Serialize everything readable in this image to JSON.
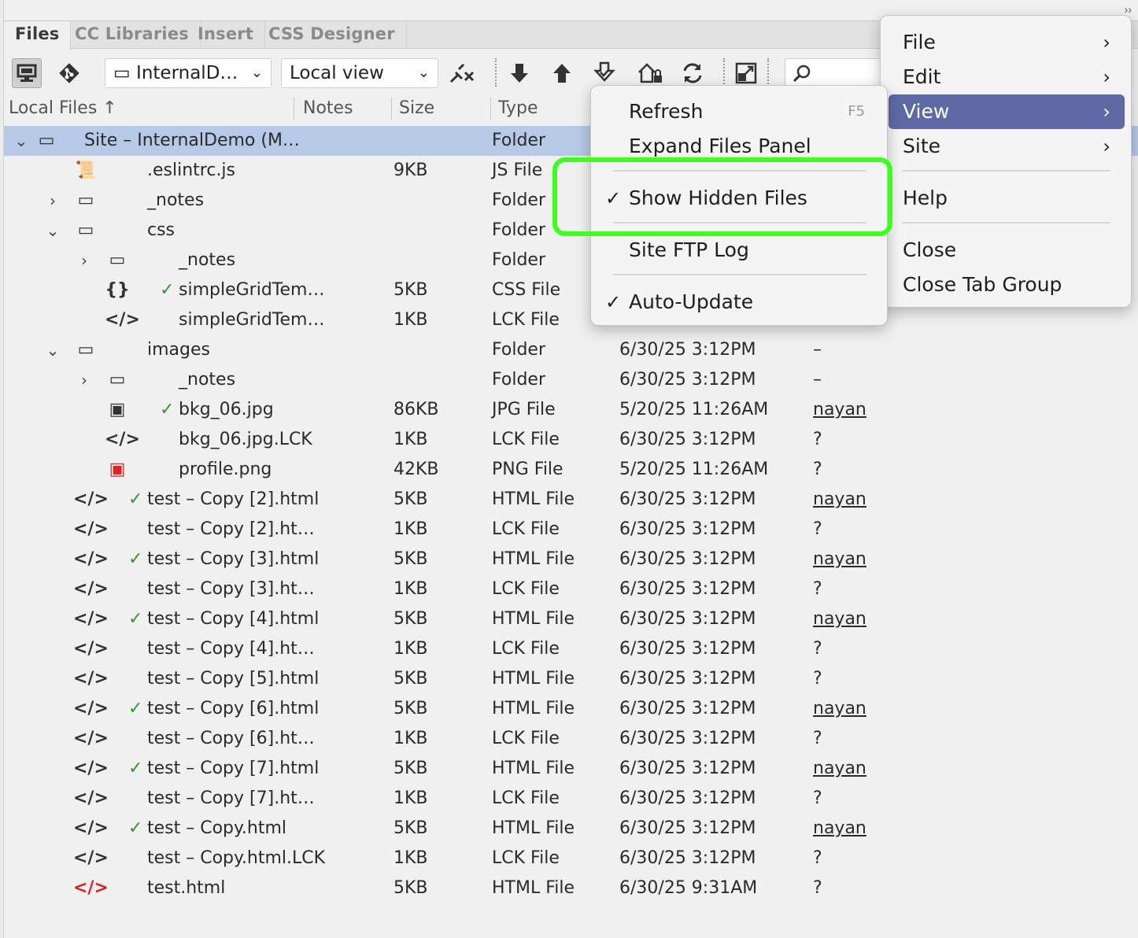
{
  "tabs": [
    "Files",
    "CC Libraries",
    "Insert",
    "CSS Designer"
  ],
  "toolbar": {
    "site_select": "InternalD…",
    "view_select": "Local view",
    "icons": [
      "monitor-icon",
      "git-icon",
      "disconnect-icon",
      "get-files-icon",
      "put-files-icon",
      "check-out-icon",
      "check-in-icon",
      "refresh-icon",
      "expand-panel-icon",
      "search-icon"
    ]
  },
  "columns": {
    "local_files": "Local Files ↑",
    "notes": "Notes",
    "size": "Size",
    "type": "Type"
  },
  "rows": [
    {
      "twisty": "⌄",
      "icon": "▭",
      "check": "",
      "name": "Site – InternalDemo (M…",
      "size": "",
      "type": "Folder",
      "modified": "",
      "checked_out": ""
    },
    {
      "twisty": "",
      "icon": "📜",
      "check": "",
      "name": ".eslintrc.js",
      "size": "9KB",
      "type": "JS File",
      "modified": "",
      "checked_out": ""
    },
    {
      "twisty": "›",
      "icon": "▭",
      "check": "",
      "name": "_notes",
      "size": "",
      "type": "Folder",
      "modified": "",
      "checked_out": ""
    },
    {
      "twisty": "⌄",
      "icon": "▭",
      "check": "",
      "name": "css",
      "size": "",
      "type": "Folder",
      "modified": "",
      "checked_out": ""
    },
    {
      "twisty": "›",
      "icon": "▭",
      "check": "",
      "name": "_notes",
      "size": "",
      "type": "Folder",
      "modified": "",
      "checked_out": ""
    },
    {
      "twisty": "",
      "icon": "{}",
      "check": "✓",
      "name": "simpleGridTem…",
      "size": "5KB",
      "type": "CSS File",
      "modified": "",
      "checked_out": ""
    },
    {
      "twisty": "",
      "icon": "</>",
      "check": "",
      "name": "simpleGridTem…",
      "size": "1KB",
      "type": "LCK File",
      "modified": "",
      "checked_out": ""
    },
    {
      "twisty": "⌄",
      "icon": "▭",
      "check": "",
      "name": "images",
      "size": "",
      "type": "Folder",
      "modified": "6/30/25 3:12PM",
      "checked_out": "–"
    },
    {
      "twisty": "›",
      "icon": "▭",
      "check": "",
      "name": "_notes",
      "size": "",
      "type": "Folder",
      "modified": "6/30/25 3:12PM",
      "checked_out": "–"
    },
    {
      "twisty": "",
      "icon": "▣",
      "check": "✓",
      "name": "bkg_06.jpg",
      "size": "86KB",
      "type": "JPG File",
      "modified": "5/20/25 11:26AM",
      "checked_out": "nayan"
    },
    {
      "twisty": "",
      "icon": "</>",
      "check": "",
      "name": "bkg_06.jpg.LCK",
      "size": "1KB",
      "type": "LCK File",
      "modified": "6/30/25 3:12PM",
      "checked_out": "?"
    },
    {
      "twisty": "",
      "icon": "▣",
      "check": "",
      "name": "profile.png",
      "size": "42KB",
      "type": "PNG File",
      "modified": "5/20/25 11:26AM",
      "checked_out": "?"
    },
    {
      "twisty": "",
      "icon": "</>",
      "check": "✓",
      "name": "test – Copy [2].html",
      "size": "5KB",
      "type": "HTML File",
      "modified": "6/30/25 3:12PM",
      "checked_out": "nayan"
    },
    {
      "twisty": "",
      "icon": "</>",
      "check": "",
      "name": "test – Copy [2].ht…",
      "size": "1KB",
      "type": "LCK File",
      "modified": "6/30/25 3:12PM",
      "checked_out": "?"
    },
    {
      "twisty": "",
      "icon": "</>",
      "check": "✓",
      "name": "test – Copy [3].html",
      "size": "5KB",
      "type": "HTML File",
      "modified": "6/30/25 3:12PM",
      "checked_out": "nayan"
    },
    {
      "twisty": "",
      "icon": "</>",
      "check": "",
      "name": "test – Copy [3].ht…",
      "size": "1KB",
      "type": "LCK File",
      "modified": "6/30/25 3:12PM",
      "checked_out": "?"
    },
    {
      "twisty": "",
      "icon": "</>",
      "check": "✓",
      "name": "test – Copy [4].html",
      "size": "5KB",
      "type": "HTML File",
      "modified": "6/30/25 3:12PM",
      "checked_out": "nayan"
    },
    {
      "twisty": "",
      "icon": "</>",
      "check": "",
      "name": "test – Copy [4].ht…",
      "size": "1KB",
      "type": "LCK File",
      "modified": "6/30/25 3:12PM",
      "checked_out": "?"
    },
    {
      "twisty": "",
      "icon": "</>",
      "check": "",
      "name": "test – Copy [5].html",
      "size": "5KB",
      "type": "HTML File",
      "modified": "6/30/25 3:12PM",
      "checked_out": "?"
    },
    {
      "twisty": "",
      "icon": "</>",
      "check": "✓",
      "name": "test – Copy [6].html",
      "size": "5KB",
      "type": "HTML File",
      "modified": "6/30/25 3:12PM",
      "checked_out": "nayan"
    },
    {
      "twisty": "",
      "icon": "</>",
      "check": "",
      "name": "test – Copy [6].ht…",
      "size": "1KB",
      "type": "LCK File",
      "modified": "6/30/25 3:12PM",
      "checked_out": "?"
    },
    {
      "twisty": "",
      "icon": "</>",
      "check": "✓",
      "name": "test – Copy [7].html",
      "size": "5KB",
      "type": "HTML File",
      "modified": "6/30/25 3:12PM",
      "checked_out": "nayan"
    },
    {
      "twisty": "",
      "icon": "</>",
      "check": "",
      "name": "test – Copy [7].ht…",
      "size": "1KB",
      "type": "LCK File",
      "modified": "6/30/25 3:12PM",
      "checked_out": "?"
    },
    {
      "twisty": "",
      "icon": "</>",
      "check": "✓",
      "name": "test – Copy.html",
      "size": "5KB",
      "type": "HTML File",
      "modified": "6/30/25 3:12PM",
      "checked_out": "nayan"
    },
    {
      "twisty": "",
      "icon": "</>",
      "check": "",
      "name": "test – Copy.html.LCK",
      "size": "1KB",
      "type": "LCK File",
      "modified": "6/30/25 3:12PM",
      "checked_out": "?"
    },
    {
      "twisty": "",
      "icon": "</>",
      "check": "",
      "name": "test.html",
      "size": "5KB",
      "type": "HTML File",
      "modified": "6/30/25 9:31AM",
      "checked_out": "?"
    }
  ],
  "options_menu": {
    "items": [
      {
        "label": "File",
        "arrow": "›"
      },
      {
        "label": "Edit",
        "arrow": "›"
      },
      {
        "label": "View",
        "arrow": "›",
        "highlighted": true
      },
      {
        "label": "Site",
        "arrow": "›"
      },
      {
        "label": "Help"
      },
      {
        "label": "Close"
      },
      {
        "label": "Close Tab Group"
      }
    ]
  },
  "view_submenu": {
    "items": [
      {
        "label": "Refresh",
        "shortcut": "F5"
      },
      {
        "label": "Expand Files Panel"
      },
      {
        "label": "Show Hidden Files",
        "checked": true
      },
      {
        "label": "Site FTP Log"
      },
      {
        "label": "Auto-Update",
        "checked": true
      }
    ]
  },
  "colors": {
    "menu_highlight": "#5e6aa5",
    "selected_row": "#b6c9e6",
    "focus_outline": "#3cff1e",
    "check_green": "#2f9a2f"
  }
}
